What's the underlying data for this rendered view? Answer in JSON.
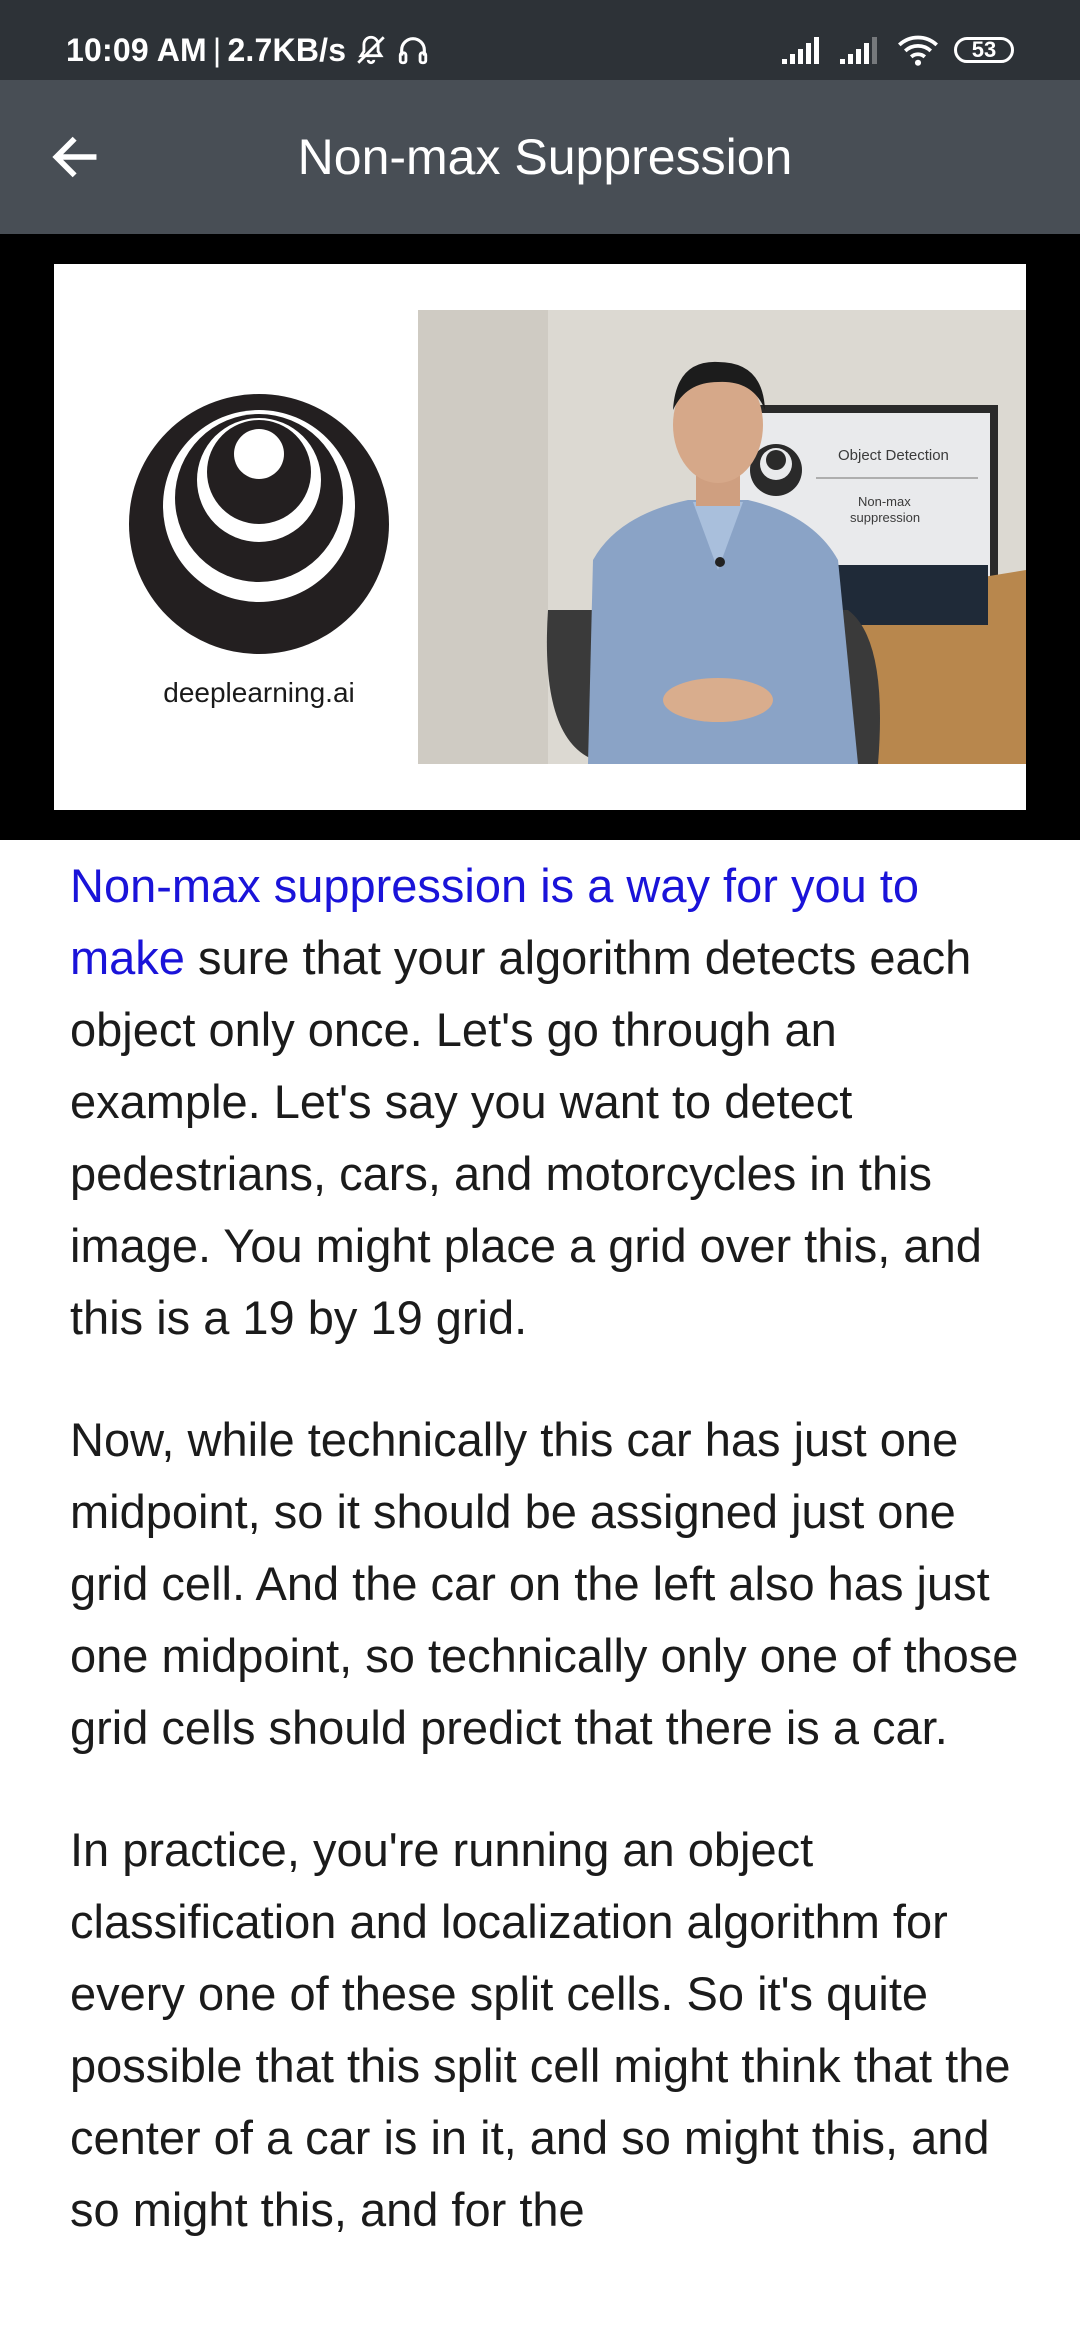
{
  "status_bar": {
    "time": "10:09 AM",
    "separator": "|",
    "speed": "2.7KB/s",
    "battery": "53"
  },
  "toolbar": {
    "title": "Non-max Suppression"
  },
  "video": {
    "logo_caption": "deeplearning.ai",
    "monitor_title": "Object Detection",
    "monitor_subtitle_1": "Non-max",
    "monitor_subtitle_2": "suppression"
  },
  "transcript": {
    "p1_highlight": "Non-max suppression is a way for you to make",
    "p1_rest": " sure that your algorithm detects each object only once. Let's go through an example. Let's say you want to detect pedestrians, cars, and motorcycles in this image. You might place a grid over this, and this is a 19 by 19 grid.",
    "p2": "Now, while technically this car has just one midpoint, so it should be assigned just one grid cell. And the car on the left also has just one midpoint, so technically only one of those grid cells should predict that there is a car.",
    "p3": "In practice, you're running an object classification and localization algorithm for every one of these split cells. So it's quite possible that this split cell might think that the center of a car is in it, and so might this, and so might this, and for the"
  },
  "colors": {
    "status_bar_bg": "#2d3237",
    "toolbar_bg": "#484e55",
    "highlight": "#1a13d9"
  }
}
